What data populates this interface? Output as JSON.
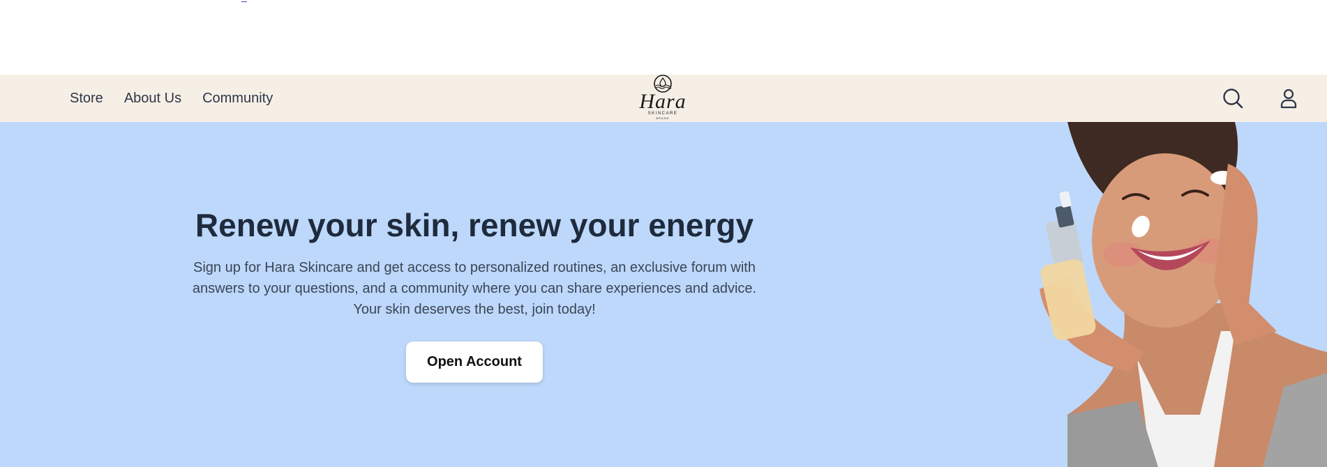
{
  "nav": {
    "links": [
      "Store",
      "About Us",
      "Community"
    ],
    "icons": {
      "search": "search-icon",
      "account": "user-icon"
    }
  },
  "brand": {
    "name": "Hara",
    "tagline": "SKINCARE",
    "sub": "BRAND"
  },
  "hero": {
    "title": "Renew your skin, renew your energy",
    "description": "Sign up for Hara Skincare and get access to personalized routines, an exclusive forum with answers to your questions, and a community where you can share experiences and advice. Your skin deserves the best, join today!",
    "cta_label": "Open Account"
  },
  "colors": {
    "navbar_bg": "#f6efe6",
    "hero_bg": "#bdd8fb",
    "title": "#1f2a3d",
    "text": "#3a4555",
    "button_bg": "#ffffff"
  }
}
